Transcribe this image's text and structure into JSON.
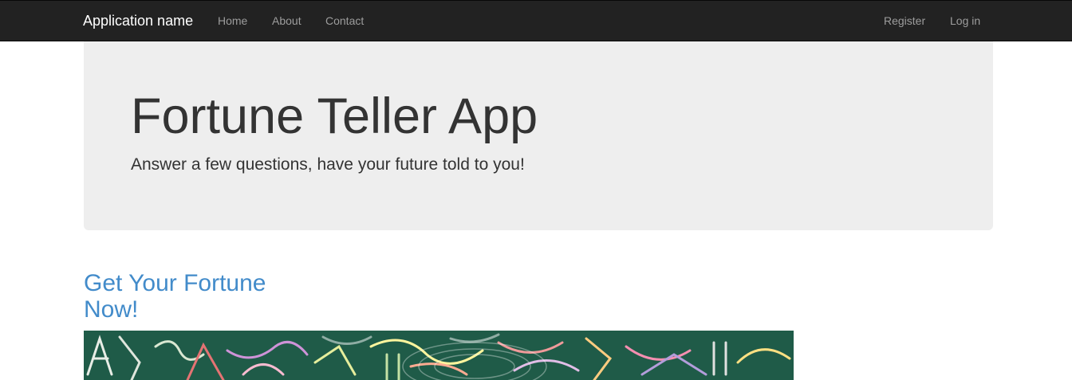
{
  "navbar": {
    "brand": "Application name",
    "links": [
      "Home",
      "About",
      "Contact"
    ],
    "right_links": [
      "Register",
      "Log in"
    ]
  },
  "jumbotron": {
    "title": "Fortune Teller App",
    "lead": "Answer a few questions, have your future told to you!"
  },
  "main": {
    "heading": "Get Your Fortune Now!"
  },
  "colors": {
    "navbar_bg": "#222222",
    "jumbotron_bg": "#eeeeee",
    "link_blue": "#428bca",
    "chalkboard_green": "#1f5b48"
  }
}
